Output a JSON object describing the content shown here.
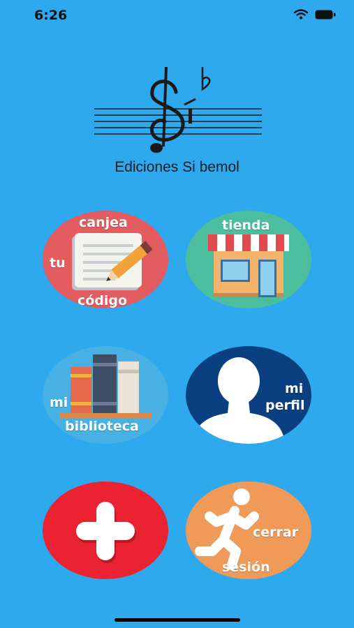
{
  "status": {
    "time": "6:26"
  },
  "brand": {
    "name": "Ediciones Si bemol"
  },
  "tiles": {
    "redeem": {
      "line1": "canjea",
      "line2": "tu",
      "line3": "código"
    },
    "store": {
      "label": "tienda"
    },
    "library": {
      "line1": "mi",
      "line2": "biblioteca"
    },
    "profile": {
      "line1": "mi",
      "line2": "perfil"
    },
    "add": {},
    "logout": {
      "line1": "cerrar",
      "line2": "sesión"
    }
  },
  "colors": {
    "background": "#2ea9ee",
    "redeem": "#e35c5f",
    "store": "#4bbf9d",
    "library": "#46b1e2",
    "profile": "#0a3f82",
    "add": "#ea2231",
    "logout": "#f09a5a"
  }
}
